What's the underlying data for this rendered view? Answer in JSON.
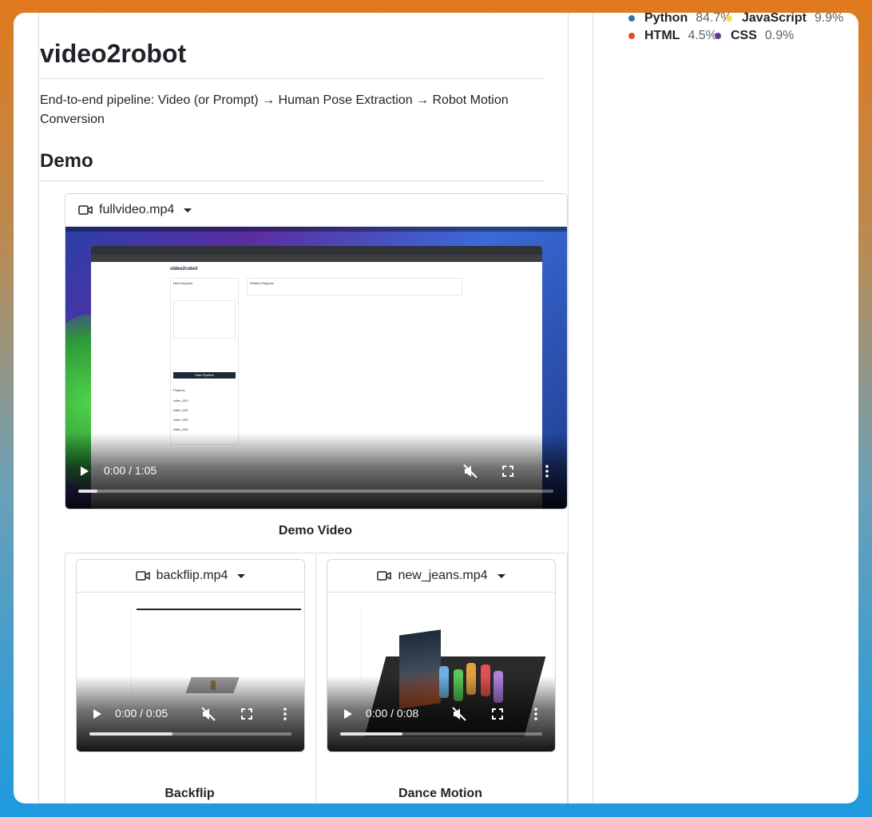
{
  "repo": {
    "title": "video2robot",
    "description": "End-to-end pipeline: Video (or Prompt) → Human Pose Extraction → Robot Motion Conversion",
    "demo_heading": "Demo"
  },
  "languages": [
    {
      "name": "Python",
      "percent": "84.7%",
      "color": "#3572A5"
    },
    {
      "name": "JavaScript",
      "percent": "9.9%",
      "color": "#f1e05a"
    },
    {
      "name": "HTML",
      "percent": "4.5%",
      "color": "#e34c26"
    },
    {
      "name": "CSS",
      "percent": "0.9%",
      "color": "#663399"
    }
  ],
  "videos": {
    "main": {
      "file": "fullvideo.mp4",
      "time": "0:00 / 1:05",
      "progress": 0.04,
      "caption": "Demo Video"
    },
    "backflip": {
      "file": "backflip.mp4",
      "time": "0:00 / 0:05",
      "progress": 0.41,
      "caption": "Backflip"
    },
    "dance": {
      "file": "new_jeans.mp4",
      "time": "0:00 / 0:08",
      "progress": 0.31,
      "caption": "Dance Motion"
    }
  },
  "screen": {
    "app_title": "video2robot",
    "new_request": "New Request",
    "related_request": "Related Request",
    "start_button": "Start Pipeline",
    "projects": "Projects",
    "rows": [
      "video_001",
      "video_002",
      "video_003",
      "video_004"
    ]
  }
}
